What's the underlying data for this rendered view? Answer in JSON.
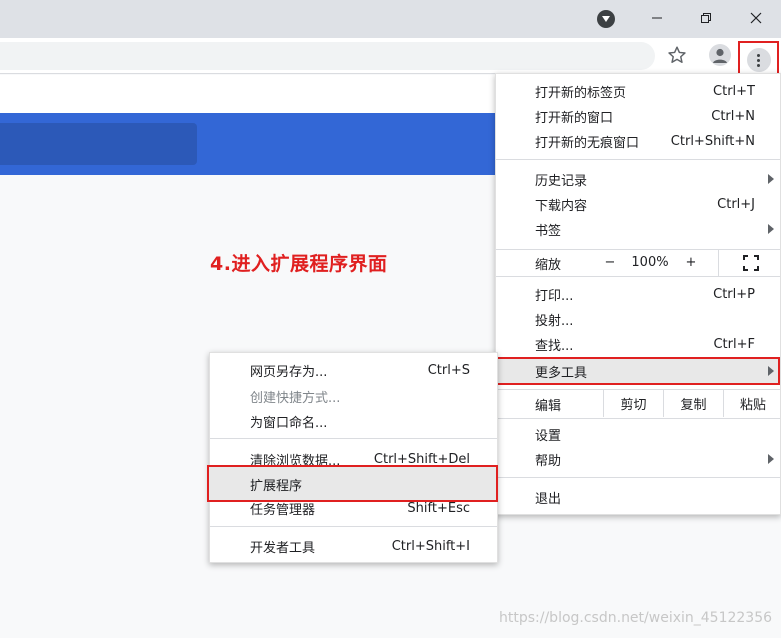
{
  "window": {
    "profile_icon": "chevron-down-circle-icon",
    "minimize_icon": "minimize-icon",
    "restore_icon": "restore-icon",
    "close_icon": "close-icon"
  },
  "toolbar": {
    "star_icon": "bookmark-star-icon",
    "profile_icon": "profile-avatar-icon",
    "menu_icon": "kebab-menu-icon"
  },
  "annotation": "4.进入扩展程序界面",
  "main_menu": {
    "new_tab": {
      "label": "打开新的标签页",
      "shortcut": "Ctrl+T"
    },
    "new_window": {
      "label": "打开新的窗口",
      "shortcut": "Ctrl+N"
    },
    "incognito": {
      "label": "打开新的无痕窗口",
      "shortcut": "Ctrl+Shift+N"
    },
    "history": {
      "label": "历史记录"
    },
    "downloads": {
      "label": "下载内容",
      "shortcut": "Ctrl+J"
    },
    "bookmarks": {
      "label": "书签"
    },
    "zoom": {
      "label": "缩放",
      "minus": "−",
      "value": "100%",
      "plus": "+"
    },
    "print": {
      "label": "打印...",
      "shortcut": "Ctrl+P"
    },
    "cast": {
      "label": "投射..."
    },
    "find": {
      "label": "查找...",
      "shortcut": "Ctrl+F"
    },
    "more_tools": {
      "label": "更多工具"
    },
    "edit": {
      "label": "编辑",
      "cut": "剪切",
      "copy": "复制",
      "paste": "粘贴"
    },
    "settings": {
      "label": "设置"
    },
    "help": {
      "label": "帮助"
    },
    "exit": {
      "label": "退出"
    }
  },
  "sub_menu": {
    "save_page": {
      "label": "网页另存为...",
      "shortcut": "Ctrl+S"
    },
    "create_shortcut": {
      "label": "创建快捷方式..."
    },
    "name_window": {
      "label": "为窗口命名..."
    },
    "clear_data": {
      "label": "清除浏览数据...",
      "shortcut": "Ctrl+Shift+Del"
    },
    "extensions": {
      "label": "扩展程序"
    },
    "task_manager": {
      "label": "任务管理器",
      "shortcut": "Shift+Esc"
    },
    "dev_tools": {
      "label": "开发者工具",
      "shortcut": "Ctrl+Shift+I"
    }
  },
  "watermark": "https://blog.csdn.net/weixin_45122356",
  "colors": {
    "accent_red": "#e02020",
    "banner_blue": "#3367d6",
    "titlebar": "#dee1e6"
  }
}
